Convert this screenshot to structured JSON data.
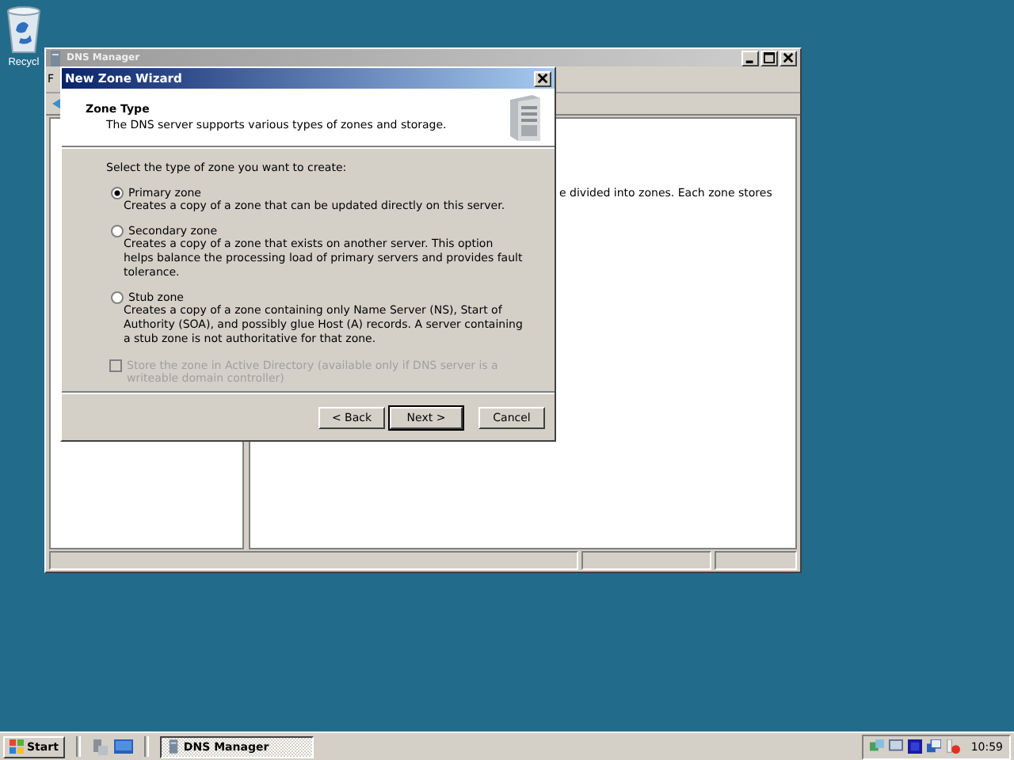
{
  "desktop": {
    "icons": [
      {
        "label": "Recycl"
      }
    ]
  },
  "main_window": {
    "title": "DNS Manager",
    "active": false,
    "menu": [
      "F"
    ],
    "content_text": "e divided into zones. Each zone stores"
  },
  "dialog": {
    "title": "New Zone Wizard",
    "header": {
      "title": "Zone Type",
      "subtitle": "The DNS server supports various types of zones and storage."
    },
    "prompt": "Select the type of zone you want to create:",
    "options": [
      {
        "label": "Primary zone",
        "description": "Creates a copy of a zone that can be updated directly on this server.",
        "selected": true
      },
      {
        "label": "Secondary zone",
        "description": "Creates a copy of a zone that exists on another server. This option helps balance the processing load of primary servers and provides fault tolerance.",
        "selected": false
      },
      {
        "label": "Stub zone",
        "description": "Creates a copy of a zone containing only Name Server (NS), Start of Authority (SOA), and possibly glue Host (A) records. A server containing a stub zone is not authoritative for that zone.",
        "selected": false
      }
    ],
    "store_in_ad": {
      "label": "Store the zone in Active Directory (available only if DNS server is a writeable domain controller)",
      "checked": false,
      "disabled": true
    },
    "buttons": [
      {
        "label": "< Back",
        "default": false
      },
      {
        "label": "Next >",
        "default": true
      },
      {
        "label": "Cancel",
        "default": false
      }
    ]
  },
  "taskbar": {
    "start": "Start",
    "tasks": [
      {
        "label": "DNS Manager",
        "selected": true
      }
    ],
    "clock": "10:59"
  }
}
